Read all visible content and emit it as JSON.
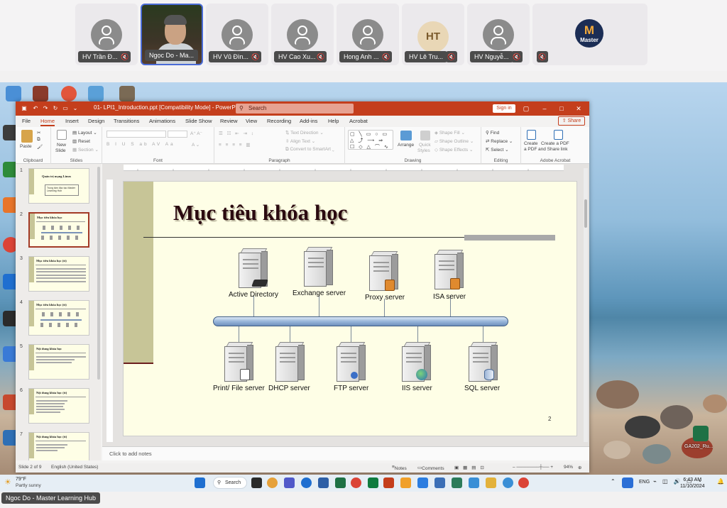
{
  "participants": [
    {
      "name": "HV Trần Đ...",
      "kind": "avatar"
    },
    {
      "name": "Ngọc Do - Ma...",
      "kind": "video"
    },
    {
      "name": "HV Vũ Đìn...",
      "kind": "avatar"
    },
    {
      "name": "HV Cao Xu...",
      "kind": "avatar"
    },
    {
      "name": "Hong Anh ...",
      "kind": "avatar"
    },
    {
      "name": "HV Lê Tru...",
      "kind": "initials",
      "initials": "HT"
    },
    {
      "name": "HV Nguyễ...",
      "kind": "avatar"
    },
    {
      "name": "",
      "kind": "logo",
      "logo_text": "Master",
      "logo_letter": "M"
    }
  ],
  "speaker_caption": "Ngoc Do - Master Learning Hub",
  "ppt": {
    "window_title": "01- LPI1_Introduction.ppt [Compatibility Mode] - PowerPoint",
    "search_placeholder": "Search",
    "sign_in": "Sign in",
    "share": "Share",
    "tabs": [
      "File",
      "Home",
      "Insert",
      "Design",
      "Transitions",
      "Animations",
      "Slide Show",
      "Review",
      "View",
      "Recording",
      "Add-ins",
      "Help",
      "Acrobat"
    ],
    "active_tab": "Home",
    "ribbon": {
      "clipboard": {
        "label": "Clipboard",
        "paste": "Paste"
      },
      "slides": {
        "label": "Slides",
        "new_slide": "New",
        "new_slide2": "Slide",
        "layout": "Layout",
        "reset": "Reset",
        "section": "Section"
      },
      "font": {
        "label": "Font"
      },
      "paragraph": {
        "label": "Paragraph",
        "text_direction": "Text Direction",
        "align_text": "Align Text",
        "convert": "Convert to SmartArt"
      },
      "drawing": {
        "label": "Drawing",
        "arrange": "Arrange",
        "quick_styles": "Quick",
        "quick_styles2": "Styles",
        "shape_fill": "Shape Fill",
        "shape_outline": "Shape Outline",
        "shape_effects": "Shape Effects"
      },
      "editing": {
        "label": "Editing",
        "find": "Find",
        "replace": "Replace",
        "select": "Select"
      },
      "acrobat": {
        "label": "Adobe Acrobat",
        "create_pdf": "Create",
        "create_pdf2": "a PDF",
        "create_share": "Create a PDF",
        "create_share2": "and Share link"
      }
    },
    "thumbnails": [
      {
        "num": "1",
        "title": "Quản trị mạng Linux",
        "sub": "Trung tâm đào tạo Master Learning Hub"
      },
      {
        "num": "2",
        "title": "Mục tiêu khóa học"
      },
      {
        "num": "3",
        "title": "Mục tiêu khóa học (tt)"
      },
      {
        "num": "4",
        "title": "Mục tiêu khóa học (tt)"
      },
      {
        "num": "5",
        "title": "Nội dung khóa học"
      },
      {
        "num": "6",
        "title": "Nội dung khóa học (tt)"
      },
      {
        "num": "7",
        "title": "Nội dung khóa học (tt)"
      }
    ],
    "slide": {
      "title": "Mục tiêu khóa học",
      "page": "2",
      "top_servers": [
        "Active Directory",
        "Exchange server",
        "Proxy server",
        "ISA server"
      ],
      "bottom_servers": [
        "Print/ File server",
        "DHCP server",
        "FTP server",
        "IIS server",
        "SQL server"
      ]
    },
    "notes_placeholder": "Click to add notes",
    "status": {
      "slide": "Slide 2 of 9",
      "language": "English (United States)",
      "notes": "Notes",
      "comments": "Comments",
      "zoom": "94%"
    }
  },
  "taskbar": {
    "weather_temp": "79°F",
    "weather_text": "Partly sunny",
    "search": "Search",
    "lang": "ENG",
    "time": "6:43 AM",
    "date": "11/10/2024"
  },
  "desktop_file": "GA202_Ru..."
}
